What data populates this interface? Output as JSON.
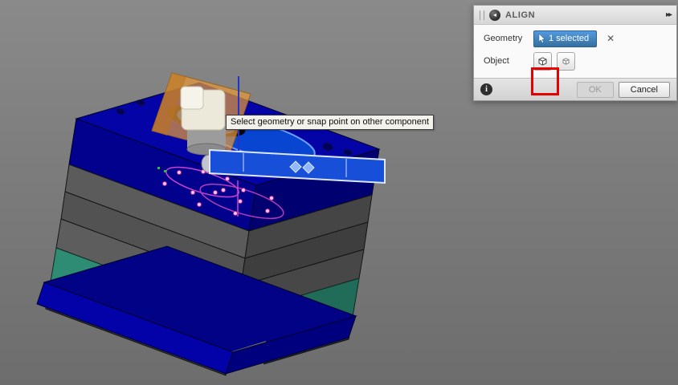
{
  "viewport": {
    "tooltip": "Select geometry or snap point on other component"
  },
  "dialog": {
    "title": "ALIGN",
    "geometry": {
      "label": "Geometry",
      "value": "1 selected"
    },
    "object": {
      "label": "Object"
    },
    "footer": {
      "ok": "OK",
      "cancel": "Cancel"
    },
    "icons": {
      "clear_glyph": "✕",
      "expand_glyph": "▸▸",
      "info_glyph": "i"
    }
  },
  "colors": {
    "selection_accent": "#3f7fc4",
    "annotation_red": "#e60000",
    "plate_blue": "#0101a0",
    "plate_gray": "#525252",
    "plate_teal": "#2f8c74",
    "highlight_blue": "#174fd8",
    "sketch_magenta": "#cf42cf",
    "viewport_background": "#7c7c7c"
  }
}
